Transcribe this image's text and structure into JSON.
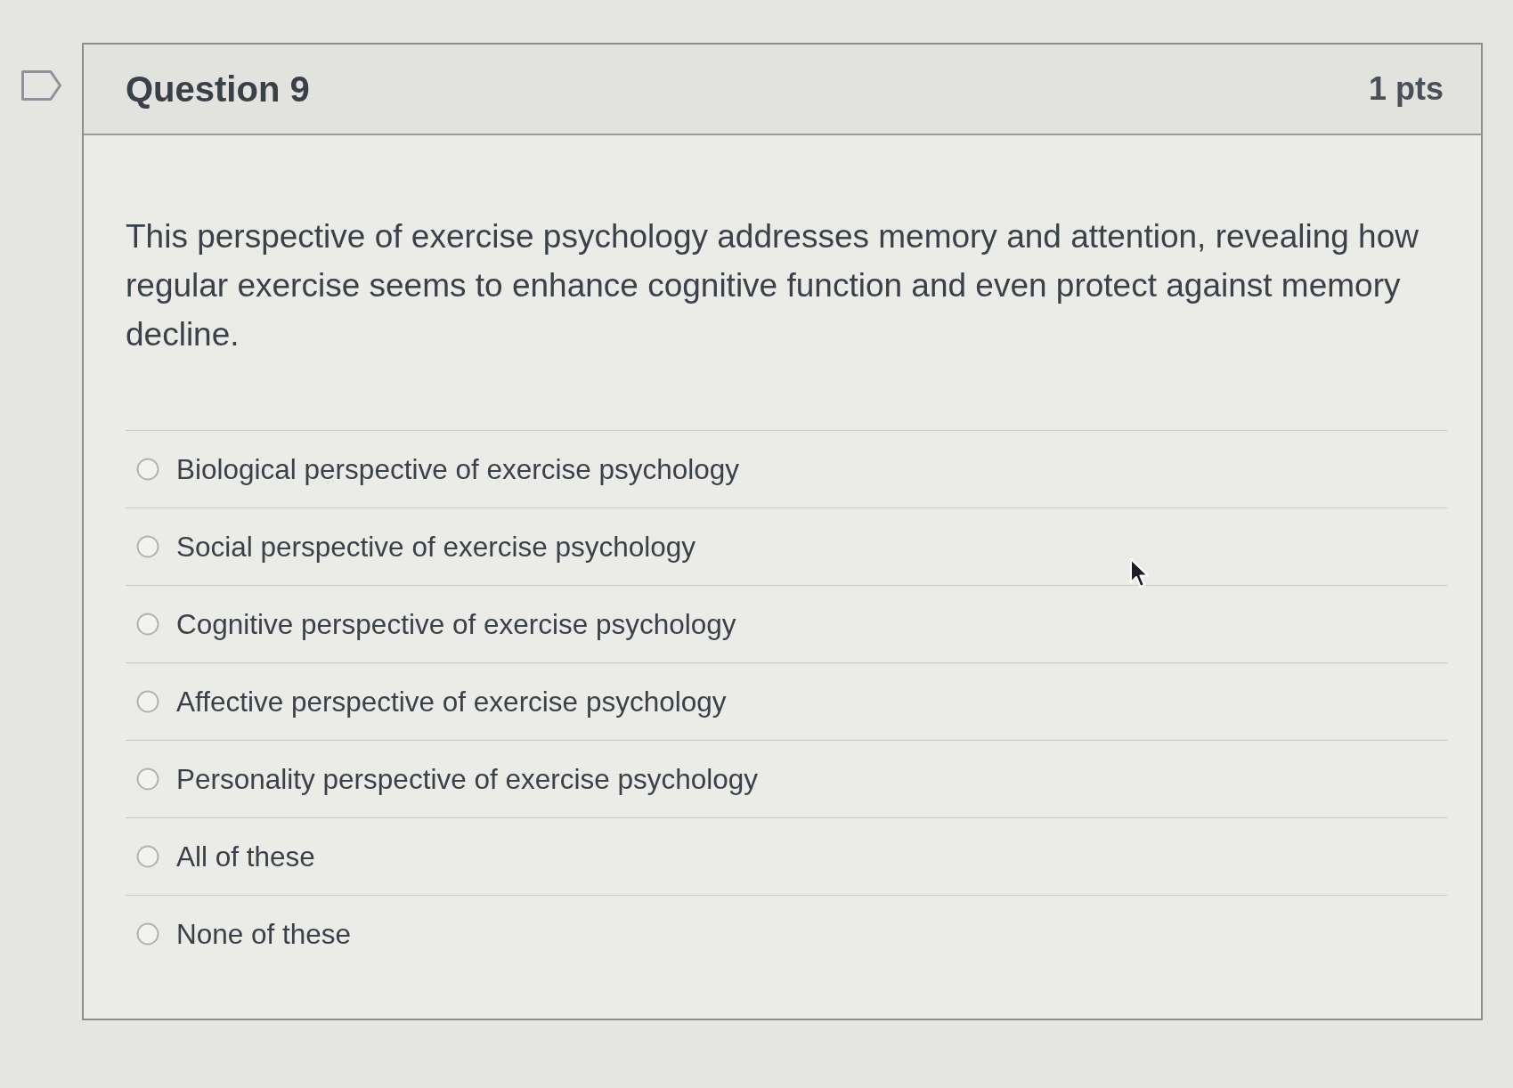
{
  "question": {
    "title": "Question 9",
    "points": "1 pts",
    "text": "This perspective of exercise psychology addresses memory and attention, revealing how regular exercise seems to enhance cognitive function and even protect against memory decline.",
    "answers": [
      {
        "label": "Biological perspective of exercise psychology",
        "selected": false
      },
      {
        "label": "Social perspective of exercise psychology",
        "selected": false
      },
      {
        "label": "Cognitive perspective of exercise psychology",
        "selected": false
      },
      {
        "label": "Affective perspective of exercise psychology",
        "selected": false
      },
      {
        "label": "Personality perspective of exercise psychology",
        "selected": false
      },
      {
        "label": "All of these",
        "selected": false
      },
      {
        "label": "None of these",
        "selected": false
      }
    ]
  }
}
